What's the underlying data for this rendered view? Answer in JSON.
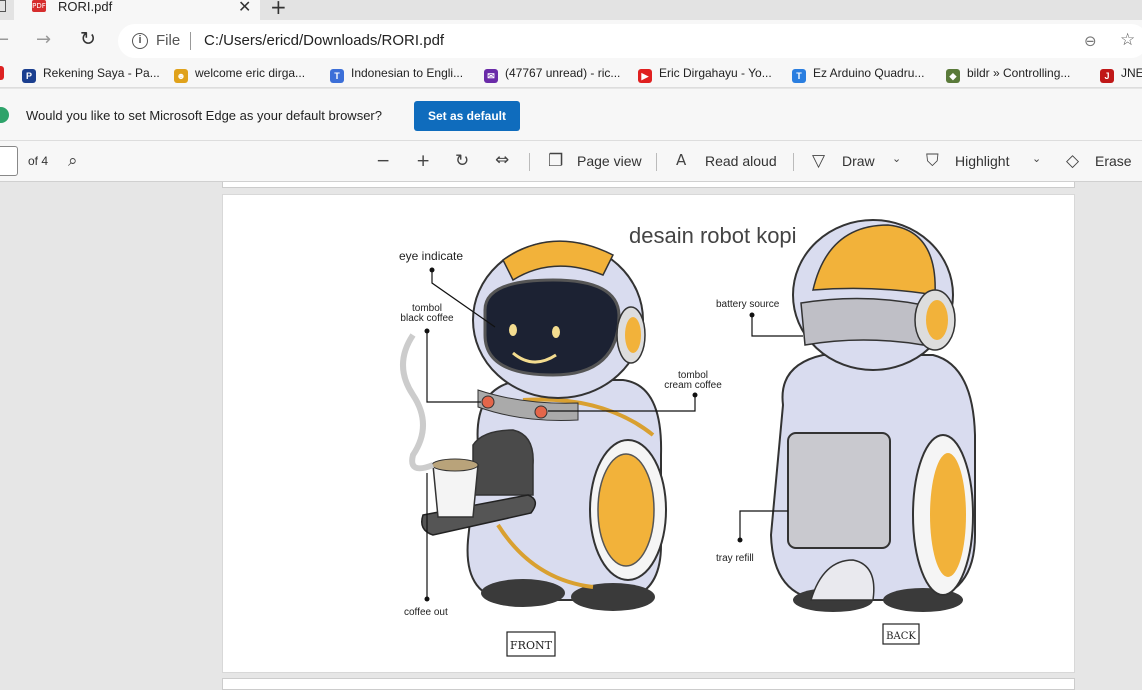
{
  "tab": {
    "title": "RORI.pdf",
    "favicon": "PDF"
  },
  "address": {
    "scheme": "File",
    "url": "C:/Users/ericd/Downloads/RORI.pdf"
  },
  "bookmarks": [
    {
      "label": "Rekening Saya - Pa...",
      "icon": "paypal-icon",
      "color": "#1b3f8f",
      "glyph": "P"
    },
    {
      "label": "welcome eric dirga...",
      "icon": "avatar-icon",
      "color": "#e0a21b",
      "glyph": "☻"
    },
    {
      "label": "Indonesian to Engli...",
      "icon": "translate-icon",
      "color": "#3c6fd8",
      "glyph": "T"
    },
    {
      "label": "(47767 unread) - ric...",
      "icon": "mail-icon",
      "color": "#6a2ba8",
      "glyph": "✉"
    },
    {
      "label": "Eric Dirgahayu - Yo...",
      "icon": "youtube-icon",
      "color": "#e02020",
      "glyph": "▶"
    },
    {
      "label": "Ez Arduino Quadru...",
      "icon": "site-icon",
      "color": "#2a7ee0",
      "glyph": "T"
    },
    {
      "label": "bildr » Controlling...",
      "icon": "cube-icon",
      "color": "#5a7a3a",
      "glyph": "◆"
    },
    {
      "label": "JNE",
      "icon": "jne-icon",
      "color": "#c01818",
      "glyph": "J"
    }
  ],
  "infobar": {
    "message": "Would you like to set Microsoft Edge as your default browser?",
    "button": "Set as default"
  },
  "pdfbar": {
    "page_total": "of 4",
    "page_view": "Page view",
    "read_aloud": "Read aloud",
    "draw": "Draw",
    "highlight": "Highlight",
    "erase": "Erase"
  },
  "document": {
    "title": "desain robot kopi",
    "labels": {
      "eye": "eye indicate",
      "black1": "tombol",
      "black2": "black coffee",
      "cream1": "tombol",
      "cream2": "cream coffee",
      "coffee_out": "coffee out",
      "battery": "battery source",
      "tray": "tray refill",
      "front": "FRONT",
      "back": "BACK"
    }
  }
}
